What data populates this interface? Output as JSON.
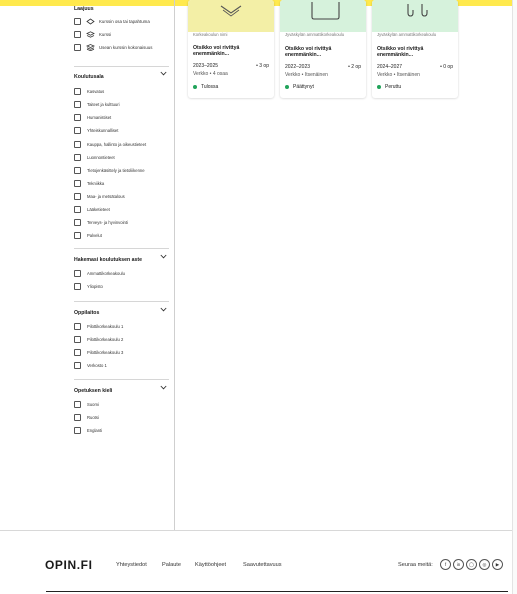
{
  "filters": {
    "course_type": {
      "title": "Laajuus",
      "items": [
        {
          "label": "Kurssin osa tai tapahtuma",
          "icon": "course-part-icon"
        },
        {
          "label": "Kurssi",
          "icon": "course-icon"
        },
        {
          "label": "Usean kurssin kokonaisuus",
          "icon": "course-stack-icon"
        }
      ]
    },
    "field": {
      "title": "Koulutusala",
      "items": [
        "Kasvatus",
        "Taiteet ja kulttuuri",
        "Humanistiset",
        "Yhteiskunnalliset",
        "Kauppa, hallinto ja oikeustieteet",
        "Luonnontieteet",
        "Tietojenkäsittely ja tietoliikenne",
        "Tekniikka",
        "Maa- ja metsätalous",
        "Lääketieteet",
        "Terveys- ja hyvinvointi",
        "Palvelut"
      ]
    },
    "level": {
      "title": "Hakemasi koulutuksen aste",
      "items": [
        "Ammattikorkeakoulu",
        "Yliopisto"
      ]
    },
    "institution": {
      "title": "Oppilaitos",
      "items": [
        "Pilottikorkeakoulu 1",
        "Pilottikorkeakoulu 2",
        "Pilottikorkeakoulu 3",
        "Verkosto 1"
      ]
    },
    "language": {
      "title": "Opetuksen kieli",
      "items": [
        "Suomi",
        "Ruotsi",
        "Englanti"
      ]
    }
  },
  "cards": [
    {
      "org": "Korkeakoulun nimi",
      "title": "Otsikko voi rivittyä enemmänkin...",
      "years": "2023–2025",
      "credits": "• 3 op",
      "mode": "Verkko • 4 osaa",
      "status": "Tulossa",
      "image_color": "#f3efa6"
    },
    {
      "org": "Jyväskylän ammattikorkeakoulu",
      "title": "Otsikko voi rivittyä enemmänkin...",
      "years": "2022–2023",
      "credits": "• 2 op",
      "mode": "Verkko • Itsenäinen",
      "status": "Päättynyt",
      "image_color": "#d6f2dc"
    },
    {
      "org": "Jyväskylän ammattikorkeakoulu",
      "title": "Otsikko voi rivittyä enemmänkin...",
      "years": "2024–2027",
      "credits": "• 0 op",
      "mode": "Verkko • Itsenäinen",
      "status": "Peruttu",
      "image_color": "#d6f2dc"
    }
  ],
  "footer": {
    "logo": "OPIN.FI",
    "links": [
      "Yhteystiedot",
      "Palaute",
      "Käyttöohjeet",
      "Saavutettavuus"
    ],
    "follow_label": "Seuraa meitä:",
    "social": [
      {
        "label": "f",
        "icon": "facebook-icon"
      },
      {
        "label": "in",
        "icon": "linkedin-icon"
      },
      {
        "label": "◯",
        "icon": "twitter-icon"
      },
      {
        "label": "◎",
        "icon": "instagram-icon"
      },
      {
        "label": "▶",
        "icon": "youtube-icon"
      }
    ]
  },
  "colors": {
    "accent_yellow": "#ffe94d",
    "status_dot": "#21a35a"
  }
}
